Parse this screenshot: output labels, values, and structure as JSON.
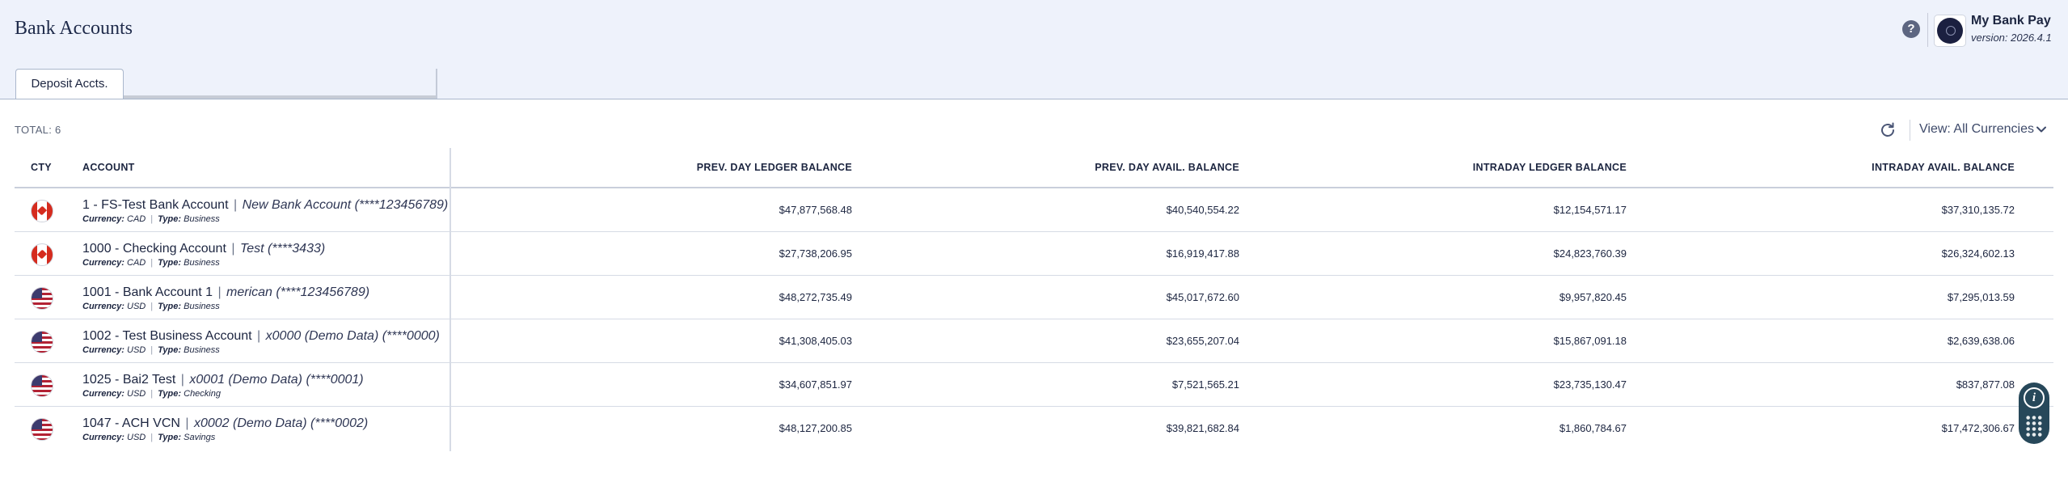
{
  "header": {
    "title": "Bank Accounts",
    "help_label": "?",
    "app_name": "My Bank Pay",
    "app_version": "version: 2026.4.1"
  },
  "tabs": [
    {
      "label": "Deposit Accts.",
      "active": true
    }
  ],
  "toolbar": {
    "total_label": "TOTAL: 6",
    "view_label": "View: All Currencies",
    "refresh_icon": "refresh-icon",
    "dropdown_icon": "chevron-down-icon"
  },
  "table": {
    "columns": {
      "cty": "CTY",
      "account": "ACCOUNT",
      "prev_ledger": "PREV. DAY LEDGER BALANCE",
      "prev_avail": "PREV. DAY AVAIL. BALANCE",
      "intraday_ledger": "INTRADAY LEDGER BALANCE",
      "intraday_avail": "INTRADAY AVAIL. BALANCE"
    },
    "labels": {
      "currency": "Currency:",
      "type": "Type:"
    },
    "rows": [
      {
        "country": "ca",
        "name": "1 - FS-Test Bank Account",
        "nickname": "New Bank Account (****123456789)",
        "currency": "CAD",
        "type": "Business",
        "prev_ledger": "$47,877,568.48",
        "prev_avail": "$40,540,554.22",
        "intraday_ledger": "$12,154,571.17",
        "intraday_avail": "$37,310,135.72"
      },
      {
        "country": "ca",
        "name": "1000 - Checking Account",
        "nickname": "Test (****3433)",
        "currency": "CAD",
        "type": "Business",
        "prev_ledger": "$27,738,206.95",
        "prev_avail": "$16,919,417.88",
        "intraday_ledger": "$24,823,760.39",
        "intraday_avail": "$26,324,602.13"
      },
      {
        "country": "us",
        "name": "1001 - Bank Account 1",
        "nickname": "merican (****123456789)",
        "currency": "USD",
        "type": "Business",
        "prev_ledger": "$48,272,735.49",
        "prev_avail": "$45,017,672.60",
        "intraday_ledger": "$9,957,820.45",
        "intraday_avail": "$7,295,013.59"
      },
      {
        "country": "us",
        "name": "1002 - Test Business Account",
        "nickname": "x0000 (Demo Data) (****0000)",
        "currency": "USD",
        "type": "Business",
        "prev_ledger": "$41,308,405.03",
        "prev_avail": "$23,655,207.04",
        "intraday_ledger": "$15,867,091.18",
        "intraday_avail": "$2,639,638.06"
      },
      {
        "country": "us",
        "name": "1025 - Bai2 Test",
        "nickname": "x0001 (Demo Data) (****0001)",
        "currency": "USD",
        "type": "Checking",
        "prev_ledger": "$34,607,851.97",
        "prev_avail": "$7,521,565.21",
        "intraday_ledger": "$23,735,130.47",
        "intraday_avail": "$837,877.08"
      },
      {
        "country": "us",
        "name": "1047 - ACH VCN",
        "nickname": "x0002 (Demo Data) (****0002)",
        "currency": "USD",
        "type": "Savings",
        "prev_ledger": "$48,127,200.85",
        "prev_avail": "$39,821,682.84",
        "intraday_ledger": "$1,860,784.67",
        "intraday_avail": "$17,472,306.67"
      }
    ]
  },
  "fab": {
    "info_label": "i",
    "info_icon": "info-icon",
    "menu_icon": "keypad-grid-icon"
  }
}
